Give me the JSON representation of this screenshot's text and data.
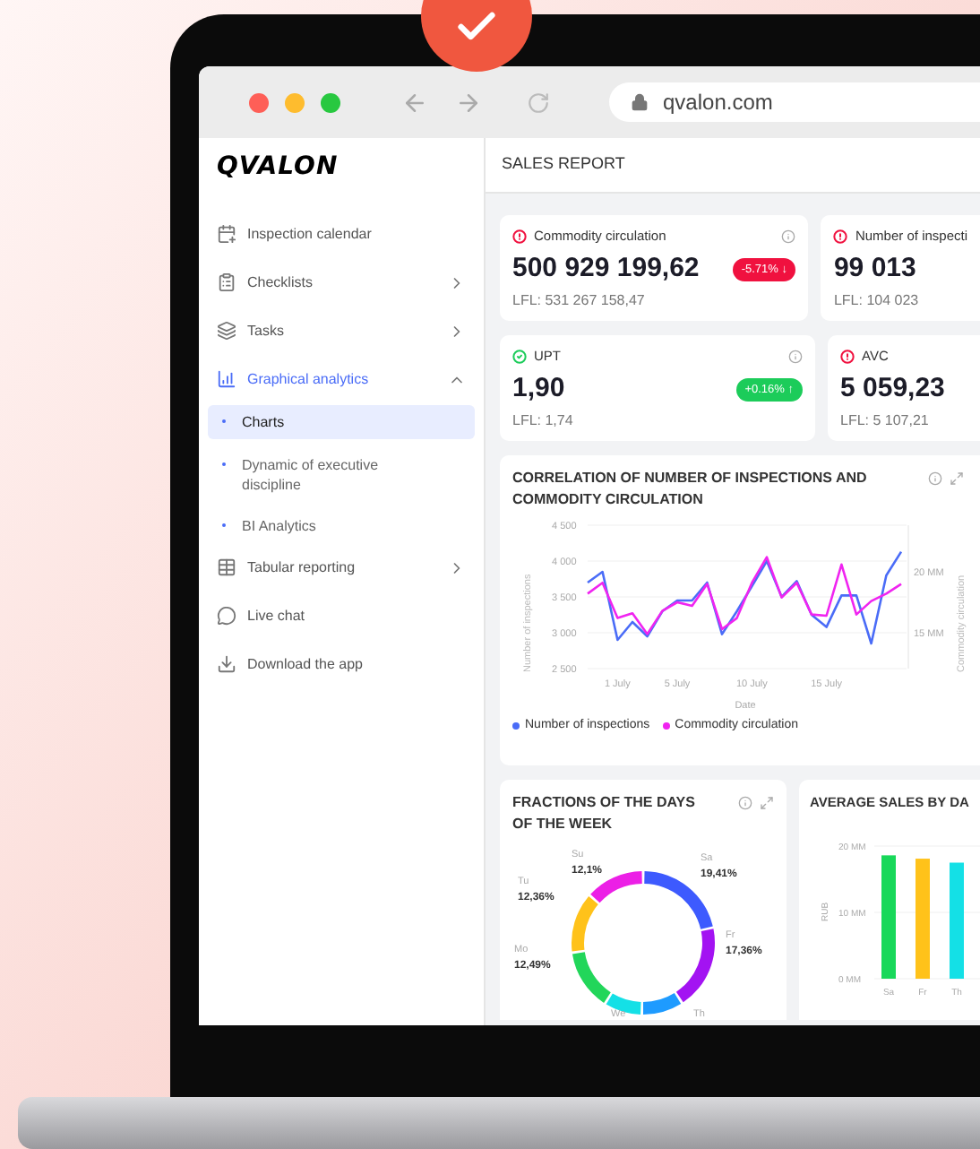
{
  "browser": {
    "url": "qvalon.com"
  },
  "app": {
    "logo": "QVALON",
    "page_title": "SALES REPORT"
  },
  "sidebar": {
    "items": [
      {
        "label": "Inspection calendar",
        "selected": false
      },
      {
        "label": "Checklists",
        "selected": false,
        "expanded": false
      },
      {
        "label": "Tasks",
        "selected": false,
        "expanded": false
      },
      {
        "label": "Graphical analytics",
        "selected": true,
        "expanded": true,
        "children": [
          {
            "label": "Charts",
            "selected": true
          },
          {
            "label": "Dynamic of executive discipline",
            "selected": false
          },
          {
            "label": "BI Analytics",
            "selected": false
          }
        ]
      },
      {
        "label": "Tabular reporting",
        "selected": false,
        "expanded": false
      },
      {
        "label": "Live chat",
        "selected": false
      },
      {
        "label": "Download the app",
        "selected": false
      }
    ]
  },
  "kpis": [
    {
      "title": "Commodity circulation",
      "ok": false,
      "value": "500 929 199,62",
      "lfl": "LFL: 531 267 158,47",
      "change": "-5.71% ↓",
      "rising": false
    },
    {
      "title": "Number of inspecti",
      "ok": false,
      "value": "99 013",
      "lfl": "LFL: 104 023"
    },
    {
      "title": "UPT",
      "ok": true,
      "value": "1,90",
      "lfl": "LFL: 1,74",
      "change": "+0.16% ↑",
      "rising": true
    },
    {
      "title": "AVC",
      "ok": false,
      "value": "5 059,23",
      "lfl": "LFL: 5 107,21"
    }
  ],
  "correlation": {
    "title": "CORRELATION OF NUMBER OF INSPECTIONS AND COMMODITY CIRCULATION",
    "left_axis": {
      "chart_data": {
        "type": "line",
        "xlabel": "Date",
        "ylabel": "Number of inspections",
        "categories": [
          null,
          null,
          "1 July",
          null,
          null,
          null,
          "5 July",
          null,
          null,
          null,
          null,
          "10 July",
          null,
          null,
          null,
          null,
          "15 July",
          null,
          null,
          null,
          null,
          null
        ],
        "grid": true,
        "ylim": [
          2500,
          4500
        ],
        "yticks": [
          {
            "value": 2500,
            "label": "2 500"
          },
          {
            "value": 3000,
            "label": "3 000"
          },
          {
            "value": 3500,
            "label": "3 500"
          },
          {
            "value": 4000,
            "label": "4 000"
          },
          {
            "value": 4500,
            "label": "4 500"
          }
        ],
        "series": [
          {
            "name": "Number of inspections",
            "color": "#4a6cf7",
            "values": [
              3700,
              3850,
              2900,
              3150,
              2950,
              3300,
              3450,
              3450,
              3700,
              2980,
              3300,
              3650,
              4000,
              3500,
              3720,
              3250,
              3080,
              3520,
              3520,
              2850,
              3800,
              4130
            ]
          }
        ]
      }
    },
    "right_axis": {
      "chart_data": {
        "type": "line",
        "ylabel": "Commodity circulation",
        "categories": [
          null,
          null,
          null,
          null,
          null,
          null,
          null,
          null,
          null,
          null,
          null,
          null,
          null,
          null,
          null,
          null,
          null,
          null,
          null,
          null,
          null,
          null
        ],
        "ylim": [
          12.06,
          23.82
        ],
        "yticks": [
          {
            "value": 15,
            "label": "15 MM"
          },
          {
            "value": 20,
            "label": "20 MM"
          }
        ],
        "series": [
          {
            "name": "Commodity circulation",
            "color": "#f024f0",
            "values": [
              18.2,
              19.1,
              16.2,
              16.6,
              14.9,
              16.8,
              17.5,
              17.2,
              19.0,
              15.3,
              16.2,
              19.1,
              21.2,
              17.9,
              19.1,
              16.5,
              16.4,
              20.6,
              16.5,
              17.6,
              18.2,
              19.0
            ]
          }
        ]
      }
    }
  },
  "fractions": {
    "chart_data": {
      "type": "donut",
      "title": "FRACTIONS OF THE DAYS OF THE WEEK",
      "categories": [
        "Sa",
        "Fr",
        "Th",
        "We",
        "Mo",
        "Tu",
        "Su"
      ],
      "values": [
        19.41,
        17.36,
        8.5,
        7.78,
        12.49,
        12.36,
        12.1
      ],
      "colors": [
        "#3d5afe",
        "#a313f2",
        "#1e9bff",
        "#14e0e6",
        "#22d65a",
        "#ffc21a",
        "#ec1fe6"
      ],
      "value_labels": [
        "19,41%",
        "17,36%",
        null,
        null,
        "12,49%",
        "12,36%",
        "12,1%"
      ]
    }
  },
  "average_sales": {
    "chart_data": {
      "type": "bar",
      "title": "AVERAGE SALES BY DA",
      "ylabel": "RUB",
      "categories": [
        "Sa",
        "Fr",
        "Th"
      ],
      "values": [
        18.6,
        18.1,
        17.5
      ],
      "colors": [
        "#18d85a",
        "#ffc21a",
        "#14e0e6"
      ],
      "ylim": [
        0,
        20
      ],
      "yticks": [
        {
          "value": 0,
          "label": "0 MM"
        },
        {
          "value": 10,
          "label": "10 MM"
        },
        {
          "value": 20,
          "label": "20 MM"
        }
      ]
    }
  }
}
